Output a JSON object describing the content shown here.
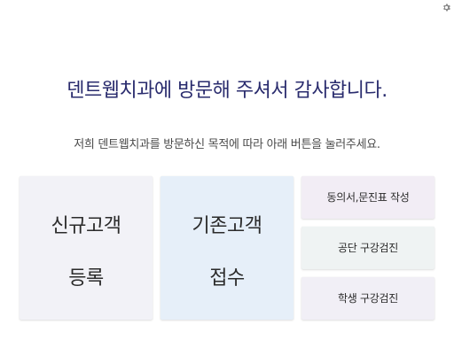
{
  "settings": {
    "icon": "gear-icon"
  },
  "headline": "덴트웹치과에 방문해 주셔서 감사합니다.",
  "subtext": "저희 덴트웹치과를 방문하신 목적에 따라 아래 버튼을 눌러주세요.",
  "buttons": {
    "new_patient": {
      "line1": "신규고객",
      "line2": "등록"
    },
    "existing_patient": {
      "line1": "기존고객",
      "line2": "접수"
    },
    "consent_form": "동의서,문진표 작성",
    "public_checkup": "공단 구강검진",
    "student_checkup": "학생 구강검진"
  },
  "colors": {
    "headline": "#2a2c6e",
    "new_patient_bg": "#f2f2f7",
    "existing_patient_bg": "#e6eff9",
    "consent_bg": "#f2edf5",
    "checkup_bg": "#eff3f3",
    "student_bg": "#f1eff6"
  }
}
